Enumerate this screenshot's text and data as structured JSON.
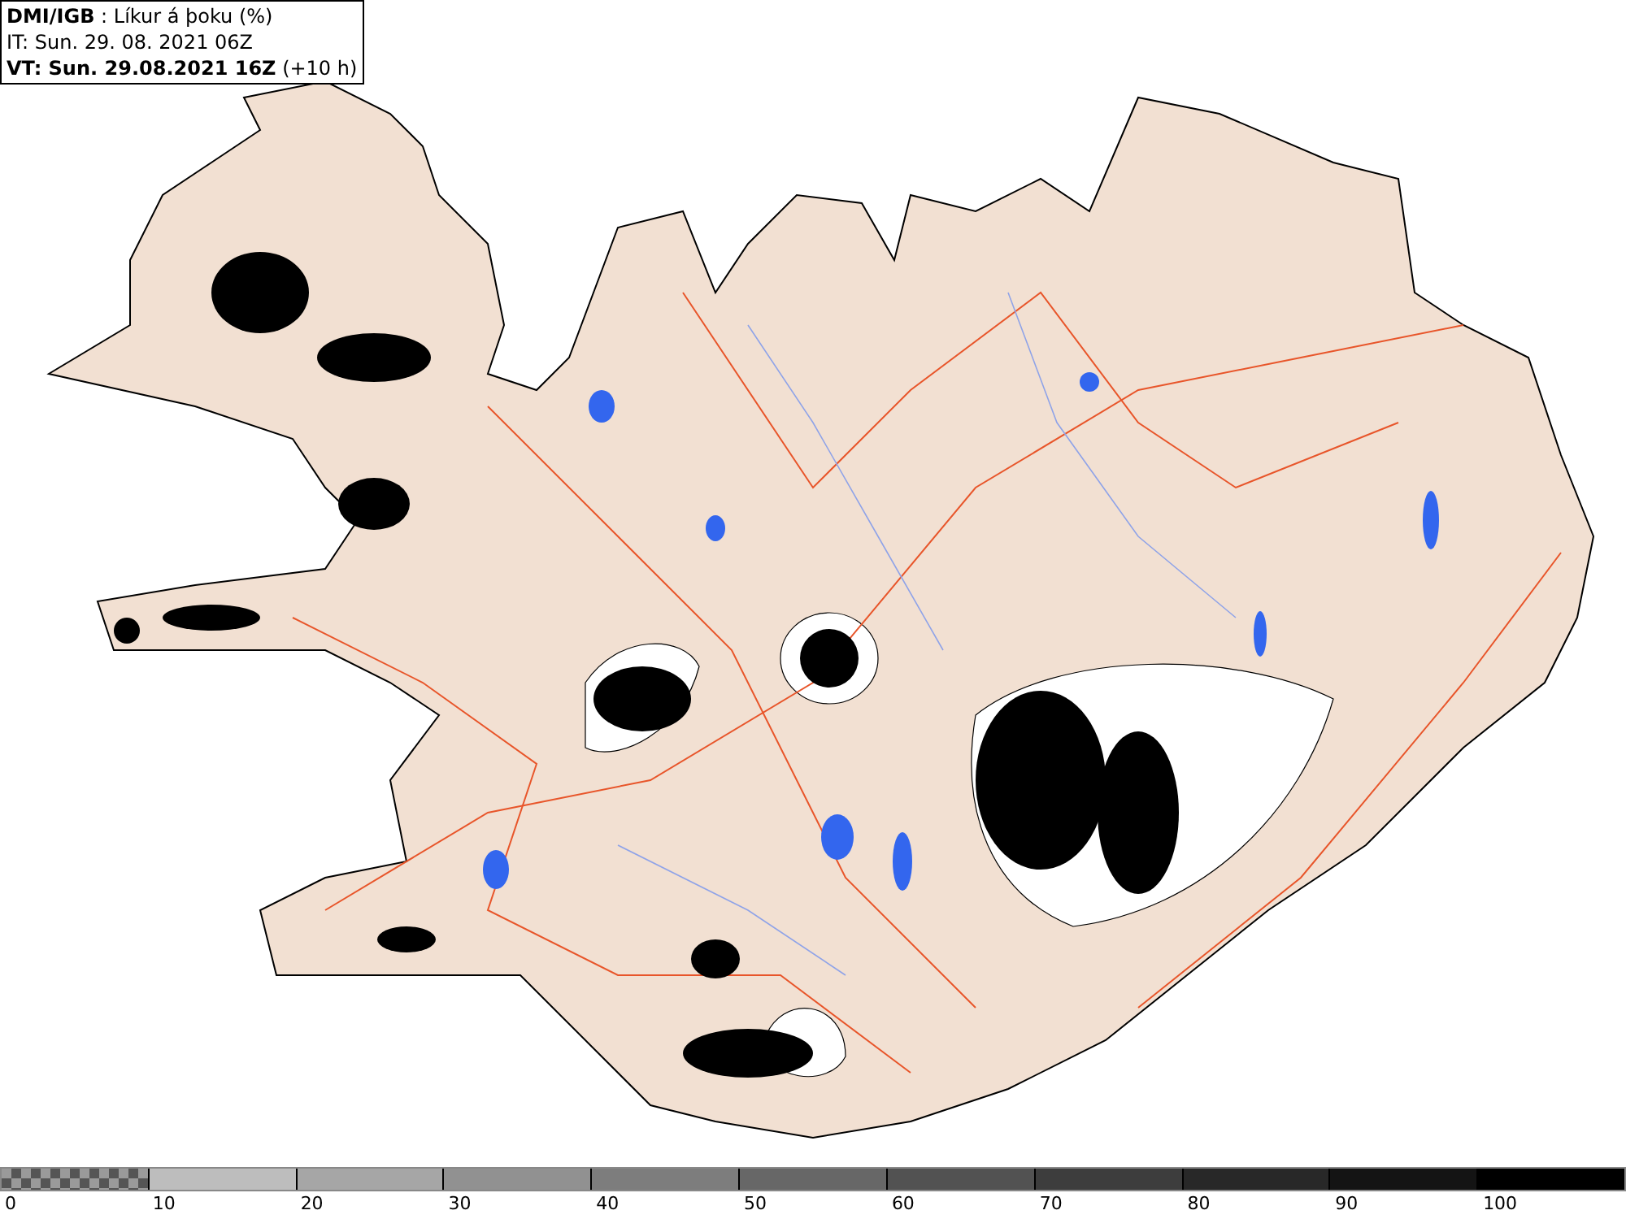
{
  "info_box": {
    "lines": [
      "**DMI/IGB** : Líkur á þoku (%)",
      "IT: Sun. 29. 08. 2021 06Z",
      "**VT: Sun. 29.08.2021 16Z** (+10 h)"
    ]
  },
  "legend": {
    "segments": [
      {
        "kind": "checker"
      },
      {
        "kind": "solid",
        "color": "#bdbdbd"
      },
      {
        "kind": "solid",
        "color": "#a6a6a6"
      },
      {
        "kind": "solid",
        "color": "#919191"
      },
      {
        "kind": "solid",
        "color": "#7d7d7d"
      },
      {
        "kind": "solid",
        "color": "#676767"
      },
      {
        "kind": "solid",
        "color": "#525252"
      },
      {
        "kind": "solid",
        "color": "#3d3d3d"
      },
      {
        "kind": "solid",
        "color": "#282828"
      },
      {
        "kind": "solid",
        "color": "#141414"
      },
      {
        "kind": "solid",
        "color": "#000000"
      }
    ],
    "labels": [
      "0",
      "10",
      "20",
      "30",
      "40",
      "50",
      "60",
      "70",
      "80",
      "90",
      "100"
    ]
  }
}
